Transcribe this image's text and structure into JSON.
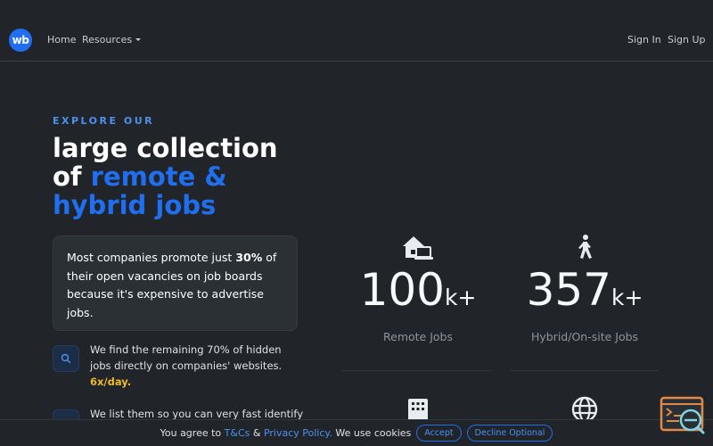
{
  "nav": {
    "logo": "wb",
    "home": "Home",
    "resources": "Resources",
    "sign_in": "Sign In",
    "sign_up": "Sign Up"
  },
  "hero": {
    "eyebrow": "EXPLORE OUR",
    "headline_line1": "large collection",
    "headline_of": "of",
    "headline_accent1": "remote &",
    "headline_accent2": "hybrid jobs",
    "intro_before": "Most companies promote just",
    "intro_bold": "30%",
    "intro_after": "of their open vacancies on job boards because it's expensive to advertise jobs."
  },
  "features": [
    {
      "icon": "search-icon",
      "text": "We find the remaining 70% of hidden jobs directly on companies' websites.",
      "highlight": "6x/day."
    },
    {
      "icon": "list-icon",
      "text": "We list them so you can very fast identify",
      "highlight": ""
    }
  ],
  "stats": [
    {
      "icon": "house-laptop-icon",
      "number": "100",
      "unit": "k+",
      "label": "Remote Jobs"
    },
    {
      "icon": "person-walking-icon",
      "number": "357",
      "unit": "k+",
      "label": "Hybrid/On-site Jobs"
    },
    {
      "icon": "building-icon",
      "number": "",
      "unit": "",
      "label": ""
    },
    {
      "icon": "globe-icon",
      "number": "",
      "unit": "",
      "label": ""
    }
  ],
  "cookie": {
    "prefix": "You agree to",
    "tcs": "T&Cs",
    "amp": "&",
    "privacy": "Privacy Policy.",
    "cookies_text": "We use cookies",
    "accept": "Accept",
    "decline": "Decline Optional"
  },
  "colors": {
    "background": "#212529",
    "accent": "#1f6ff0",
    "highlight": "#f0b92a",
    "muted": "#8d949b"
  }
}
